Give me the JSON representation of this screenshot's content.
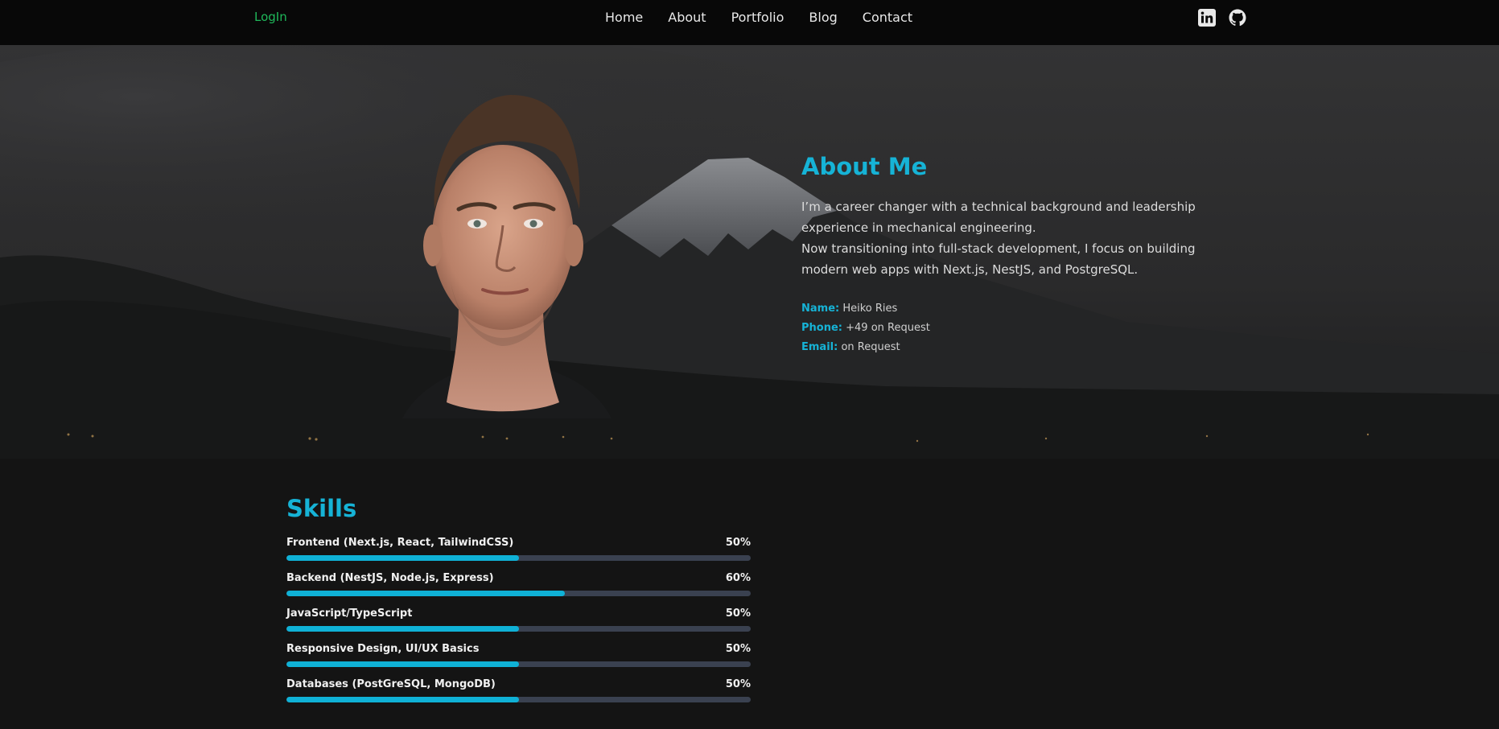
{
  "navbar": {
    "login_label": "LogIn",
    "links": [
      "Home",
      "About",
      "Portfolio",
      "Blog",
      "Contact"
    ],
    "social_icons": [
      "linkedin-icon",
      "github-icon"
    ]
  },
  "about": {
    "title": "About Me",
    "paragraph_1": "I’m a career changer with a technical background and leadership experience in mechanical engineering.",
    "paragraph_2": "Now transitioning into full-stack development, I focus on building modern web apps with Next.js, NestJS, and PostgreSQL.",
    "name_label": "Name:",
    "name_value": "Heiko Ries",
    "phone_label": "Phone:",
    "phone_value": "+49 on Request",
    "email_label": "Email:",
    "email_value": "on Request"
  },
  "skills": {
    "title": "Skills",
    "items": [
      {
        "label": "Frontend (Next.js, React, TailwindCSS)",
        "percent_label": "50%",
        "level": 50
      },
      {
        "label": "Backend (NestJS, Node.js, Express)",
        "percent_label": "60%",
        "level": 60
      },
      {
        "label": "JavaScript/TypeScript",
        "percent_label": "50%",
        "level": 50
      },
      {
        "label": "Responsive Design, UI/UX Basics",
        "percent_label": "50%",
        "level": 50
      },
      {
        "label": "Databases (PostGreSQL, MongoDB)",
        "percent_label": "50%",
        "level": 50
      }
    ]
  },
  "colors": {
    "accent": "#16b3d6",
    "login": "#1fb85a",
    "navbar_bg": "#080808",
    "bar_track": "#3a4150",
    "bar_fill": "#0fb1d6"
  }
}
